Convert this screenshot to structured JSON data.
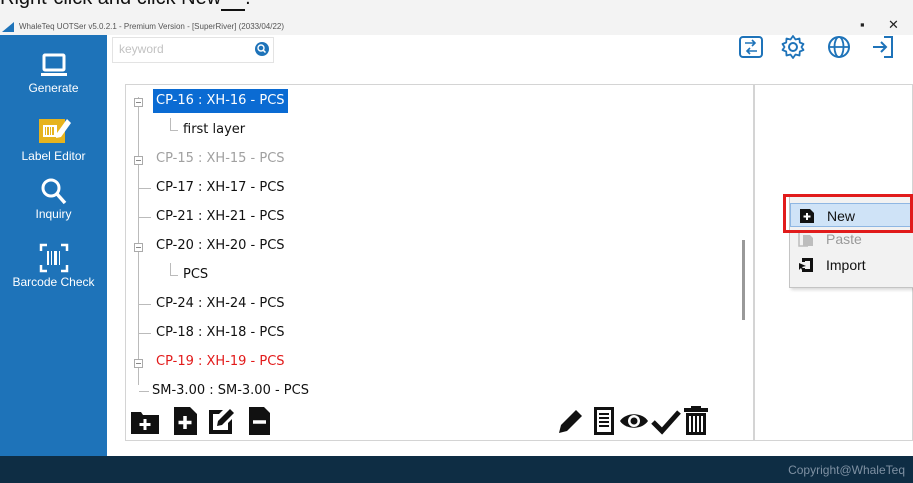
{
  "doc_caption": {
    "text": "Right-click and click New",
    "trailing": "."
  },
  "window": {
    "title": "WhaleTeq UOTSer v5.0.2.1 - Premium Version - [SuperRiver] (2033/04/22)",
    "minimize_glyph": "▪",
    "close_glyph": "✕"
  },
  "sidebar": {
    "items": [
      {
        "label": "Generate",
        "icon": "monitor-icon"
      },
      {
        "label": "Label Editor",
        "icon": "label-edit-icon"
      },
      {
        "label": "Inquiry",
        "icon": "magnifier-icon"
      },
      {
        "label": "Barcode Check",
        "icon": "barcode-scan-icon"
      }
    ]
  },
  "search": {
    "placeholder": "keyword",
    "value": ""
  },
  "toolbar_icons": [
    "import-icon",
    "gear-icon",
    "globe-icon",
    "logout-icon"
  ],
  "tree": {
    "rows": [
      {
        "label": "CP-16 : XH-16 - PCS",
        "selected": true,
        "expander": true,
        "color": "#ffffff"
      },
      {
        "label": "first layer",
        "child": true,
        "color": "#111111"
      },
      {
        "label": "CP-15 : XH-15 - PCS",
        "expander": true,
        "color": "#a0a0a0"
      },
      {
        "label": "CP-17 : XH-17 - PCS",
        "color": "#111111"
      },
      {
        "label": "CP-21 : XH-21 - PCS",
        "color": "#111111"
      },
      {
        "label": "CP-20 : XH-20 - PCS",
        "expander": true,
        "color": "#111111"
      },
      {
        "label": "PCS",
        "child": true,
        "color": "#111111"
      },
      {
        "label": "CP-24 : XH-24 - PCS",
        "color": "#111111"
      },
      {
        "label": "CP-18 : XH-18 - PCS",
        "color": "#111111"
      },
      {
        "label": "CP-19 : XH-19 - PCS",
        "expander": true,
        "color": "#e21a1a"
      },
      {
        "label": "SM-3.00 : SM-3.00 - PCS",
        "color": "#111111"
      }
    ]
  },
  "bottom_toolbar": {
    "left": [
      "add-folder-icon",
      "add-file-icon",
      "edit-file-icon",
      "remove-file-icon"
    ],
    "right": [
      "pencil-icon",
      "document-list-icon",
      "eye-icon",
      "check-icon",
      "trash-icon"
    ]
  },
  "context_menu": {
    "items": [
      {
        "label": "New",
        "icon": "new-file-icon",
        "enabled": true,
        "hovered": true
      },
      {
        "label": "Paste",
        "icon": "paste-icon",
        "enabled": false
      },
      {
        "label": "Import",
        "icon": "import-icon",
        "enabled": true
      }
    ]
  },
  "footer": {
    "copyright": "Copyright@WhaleTeq"
  },
  "colors": {
    "sidebar": "#1e73b9",
    "footer": "#0e2d44",
    "selection": "#0a6bd3",
    "highlight": "#e11b1b"
  }
}
